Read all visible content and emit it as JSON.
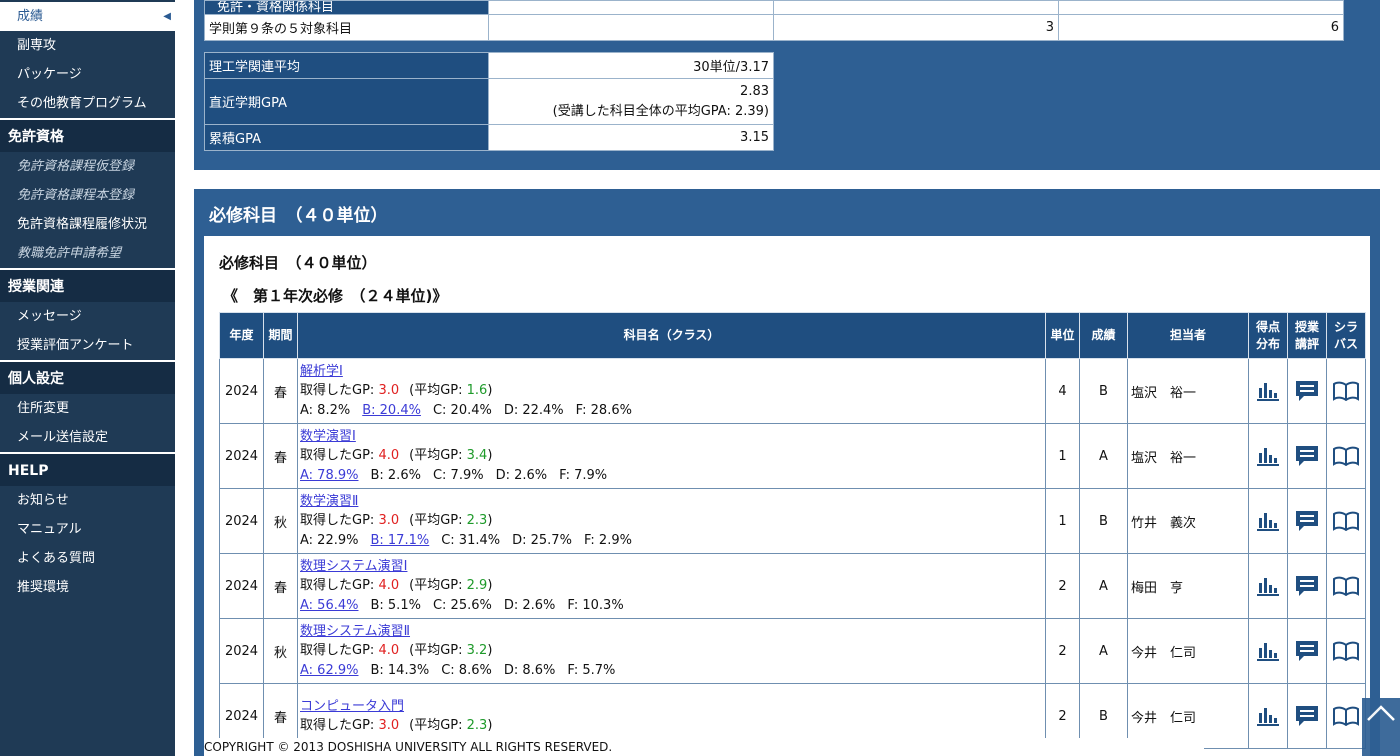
{
  "sidebar": {
    "group1": [
      {
        "label": "成績",
        "active": true
      },
      {
        "label": "副専攻"
      },
      {
        "label": "パッケージ"
      },
      {
        "label": "その他教育プログラム"
      }
    ],
    "sections": [
      {
        "title": "免許資格",
        "items": [
          {
            "label": "免許資格課程仮登録",
            "disabled": true
          },
          {
            "label": "免許資格課程本登録",
            "disabled": true
          },
          {
            "label": "免許資格課程履修状況"
          },
          {
            "label": "教職免許申請希望",
            "disabled": true
          }
        ]
      },
      {
        "title": "授業関連",
        "items": [
          {
            "label": "メッセージ"
          },
          {
            "label": "授業評価アンケート"
          }
        ]
      },
      {
        "title": "個人設定",
        "items": [
          {
            "label": "住所変更"
          },
          {
            "label": "メール送信設定"
          }
        ]
      },
      {
        "title": "HELP",
        "items": [
          {
            "label": "お知らせ"
          },
          {
            "label": "マニュアル"
          },
          {
            "label": "よくある質問"
          },
          {
            "label": "推奨環境"
          }
        ]
      }
    ]
  },
  "top_table": {
    "partial_label": "免許・資格関係科目",
    "row_label": "学則第９条の５対象科目",
    "row_values": [
      "",
      "3",
      "6"
    ]
  },
  "summary": {
    "science_avg_label": "理工学関連平均",
    "science_avg_value": "30単位/3.17",
    "recent_gpa_label": "直近学期GPA",
    "recent_gpa_value": "2.83",
    "recent_gpa_note": "(受講した科目全体の平均GPA: 2.39)",
    "cum_gpa_label": "累積GPA",
    "cum_gpa_value": "3.15"
  },
  "required": {
    "panel_title": "必修科目　（４０単位）",
    "sub_title": "必修科目　（４０単位）",
    "year_title": "《　第１年次必修　（２４単位)》",
    "headers": {
      "year": "年度",
      "term": "期間",
      "name": "科目名（クラス）",
      "units": "単位",
      "grade": "成績",
      "teacher": "担当者",
      "dist_1": "得点",
      "dist_2": "分布",
      "review_1": "授業",
      "review_2": "講評",
      "syllabus_1": "シラ",
      "syllabus_2": "バス"
    },
    "gp_label": "取得したGP: ",
    "avg_label": "(平均GP: ",
    "avg_close": ")",
    "courses": [
      {
        "year": "2024",
        "term": "春",
        "name": "解析学Ⅰ",
        "gp": "3.0",
        "avg": "1.6",
        "dist": [
          "A: 8.2%",
          "B: 20.4%",
          "C: 20.4%",
          "D: 22.4%",
          "F: 28.6%"
        ],
        "link_idx": 1,
        "units": "4",
        "grade": "B",
        "teacher": "塩沢　裕一"
      },
      {
        "year": "2024",
        "term": "春",
        "name": "数学演習Ⅰ",
        "gp": "4.0",
        "avg": "3.4",
        "dist": [
          "A: 78.9%",
          "B: 2.6%",
          "C: 7.9%",
          "D: 2.6%",
          "F: 7.9%"
        ],
        "link_idx": 0,
        "units": "1",
        "grade": "A",
        "teacher": "塩沢　裕一"
      },
      {
        "year": "2024",
        "term": "秋",
        "name": "数学演習Ⅱ",
        "gp": "3.0",
        "avg": "2.3",
        "dist": [
          "A: 22.9%",
          "B: 17.1%",
          "C: 31.4%",
          "D: 25.7%",
          "F: 2.9%"
        ],
        "link_idx": 1,
        "units": "1",
        "grade": "B",
        "teacher": "竹井　義次"
      },
      {
        "year": "2024",
        "term": "春",
        "name": "数理システム演習Ⅰ",
        "gp": "4.0",
        "avg": "2.9",
        "dist": [
          "A: 56.4%",
          "B: 5.1%",
          "C: 25.6%",
          "D: 2.6%",
          "F: 10.3%"
        ],
        "link_idx": 0,
        "units": "2",
        "grade": "A",
        "teacher": "梅田　亨"
      },
      {
        "year": "2024",
        "term": "秋",
        "name": "数理システム演習Ⅱ",
        "gp": "4.0",
        "avg": "3.2",
        "dist": [
          "A: 62.9%",
          "B: 14.3%",
          "C: 8.6%",
          "D: 8.6%",
          "F: 5.7%"
        ],
        "link_idx": 0,
        "units": "2",
        "grade": "A",
        "teacher": "今井　仁司"
      },
      {
        "year": "2024",
        "term": "春",
        "name": "コンピュータ入門",
        "gp": "3.0",
        "avg": "2.3",
        "dist": [],
        "link_idx": -1,
        "units": "2",
        "grade": "B",
        "teacher": "今井　仁司"
      }
    ]
  },
  "footer": "COPYRIGHT © 2013 DOSHISHA UNIVERSITY ALL RIGHTS RESERVED.",
  "icons": {
    "distribution": "bar-chart-icon",
    "review": "comment-icon",
    "syllabus": "book-icon",
    "scroll": "chevron-up-icon"
  },
  "colors": {
    "navy": "#1f3a55",
    "panel": "#2e5f93",
    "header": "#1f4e80",
    "gp": "#e02020",
    "avg": "#1e9a2a"
  }
}
